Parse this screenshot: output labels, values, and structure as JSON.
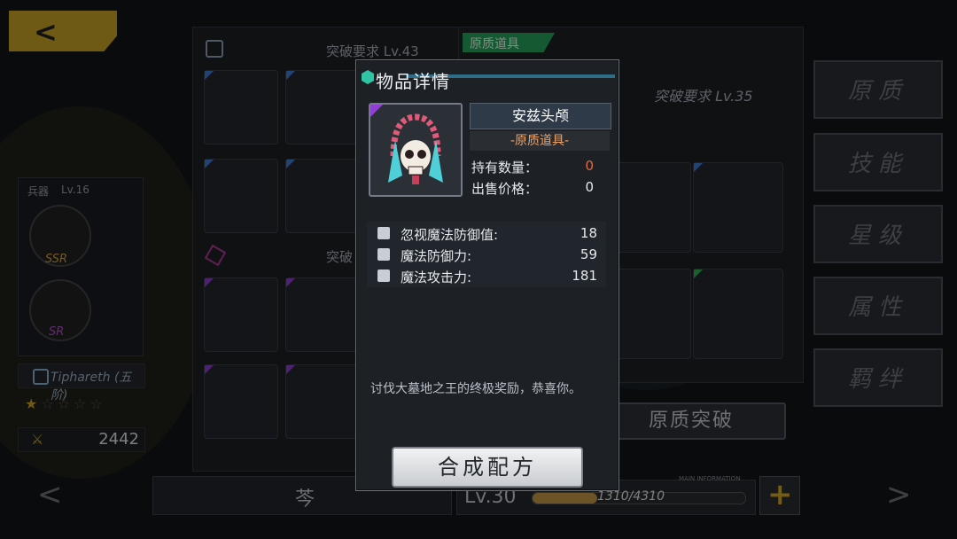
{
  "header": {
    "back_label": "back"
  },
  "left_panel": {
    "requirement": "突破要求 Lv.43",
    "section2_partial": "突破"
  },
  "character": {
    "weapon_label": "兵器",
    "weapon_level": "Lv.16",
    "grade1": "SSR",
    "grade2": "SR",
    "name": "Tiphareth (五阶)",
    "power": "2442",
    "bottom_name": "芩"
  },
  "right_panel": {
    "tag": "原质道具",
    "requirement": "突破要求 Lv.35",
    "breakthrough_button": "原质突破",
    "level": "Lv.30",
    "exp": "1310/4310",
    "exp_fraction": 0.304,
    "main_info": "MAIN INFORMATION"
  },
  "tabs": [
    {
      "label": "原质",
      "active": true
    },
    {
      "label": "技能",
      "active": false
    },
    {
      "label": "星级",
      "active": false
    },
    {
      "label": "属性",
      "active": false
    },
    {
      "label": "羁绊",
      "active": false
    }
  ],
  "modal": {
    "title": "物品详情",
    "item_name": "安兹头颅",
    "item_type": "-原质道具-",
    "owned_label": "持有数量：",
    "owned_value": "0",
    "price_label": "出售价格：",
    "price_value": "0",
    "stats": [
      {
        "label": "忽视魔法防御值:",
        "value": "18"
      },
      {
        "label": "魔法防御力:",
        "value": "59"
      },
      {
        "label": "魔法攻击力:",
        "value": "181"
      }
    ],
    "description": "讨伐大墓地之王的终极奖励，恭喜你。",
    "craft_button": "合成配方"
  },
  "colors": {
    "accent_gold": "#c9a227",
    "rarity_blue": "#3d7dd6",
    "rarity_purple": "#8f3fd2",
    "owned_zero": "#e06a3a"
  }
}
